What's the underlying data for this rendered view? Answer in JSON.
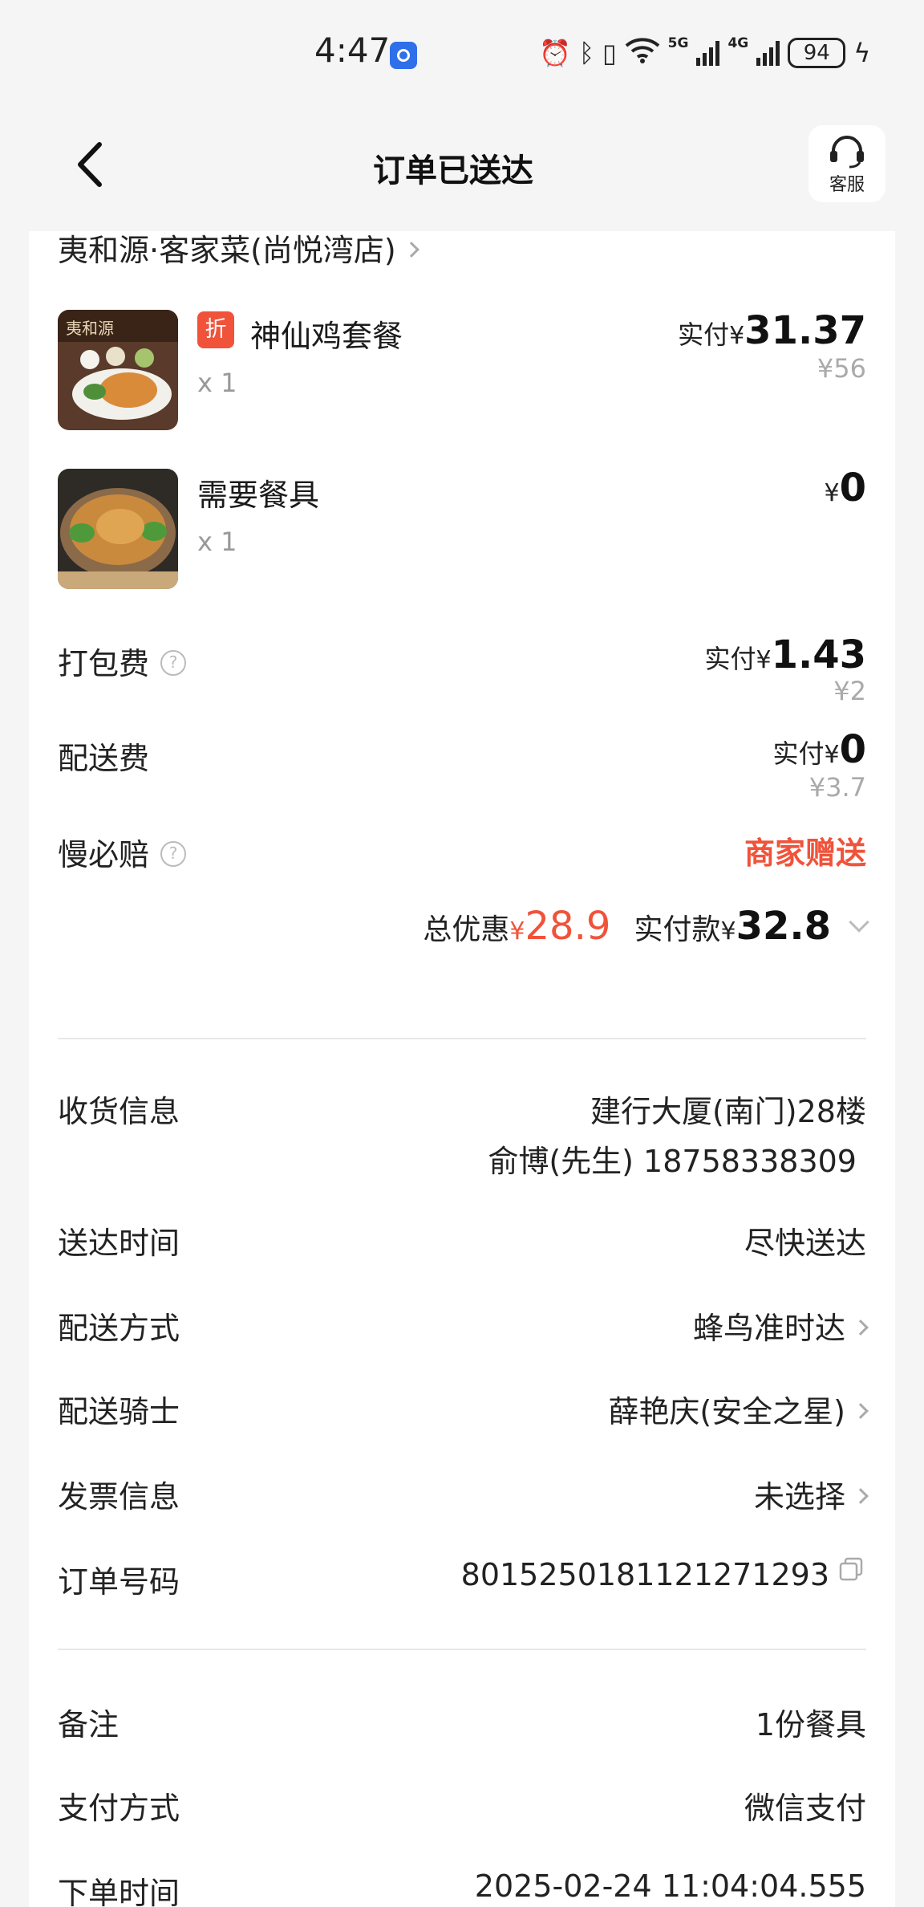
{
  "status_bar": {
    "time": "4:47",
    "network_5g": "5G",
    "network_4g": "4G",
    "battery": "94",
    "icons": [
      "app-notification-icon",
      "alarm-icon",
      "bluetooth-icon",
      "vibrate-icon",
      "wifi-icon",
      "signal-5g-icon",
      "signal-4g-icon",
      "battery-icon",
      "charging-icon"
    ]
  },
  "header": {
    "title": "订单已送达",
    "customer_service_label": "客服"
  },
  "store": {
    "name": "夷和源·客家菜(尚悦湾店)"
  },
  "items": [
    {
      "name": "神仙鸡套餐",
      "badge": "折",
      "qty": "x 1",
      "paid_label": "实付",
      "currency": "¥",
      "price": "31.37",
      "original_price": "¥56"
    },
    {
      "name": "需要餐具",
      "qty": "x 1",
      "currency": "¥",
      "price": "0"
    }
  ],
  "fees": {
    "packing": {
      "label": "打包费",
      "paid_label": "实付",
      "currency": "¥",
      "price": "1.43",
      "original": "¥2"
    },
    "delivery": {
      "label": "配送费",
      "paid_label": "实付",
      "currency": "¥",
      "price": "0",
      "original": "¥3.7"
    },
    "late_guarantee": {
      "label": "慢必赔",
      "value": "商家赠送"
    }
  },
  "summary": {
    "discount_label": "总优惠",
    "discount_currency": "¥",
    "discount_value": "28.9",
    "paid_label": "实付款",
    "paid_currency": "¥",
    "paid_value": "32.8"
  },
  "info": {
    "address_label": "收货信息",
    "address_line1": "建行大厦(南门)28楼",
    "address_line2": "俞博(先生) 18758338309",
    "delivery_time_label": "送达时间",
    "delivery_time": "尽快送达",
    "delivery_method_label": "配送方式",
    "delivery_method": "蜂鸟准时达",
    "rider_label": "配送骑士",
    "rider": "薛艳庆(安全之星)",
    "invoice_label": "发票信息",
    "invoice": "未选择",
    "order_no_label": "订单号码",
    "order_no": "8015250181121271293"
  },
  "extra": {
    "remark_label": "备注",
    "remark": "1份餐具",
    "payment_label": "支付方式",
    "payment": "微信支付",
    "order_time_label": "下单时间",
    "order_time": "2025-02-24 11:04:04.555"
  },
  "colors": {
    "accent_red": "#f0533a",
    "background": "#f5f5f5",
    "card": "#ffffff",
    "muted": "#aaaaaa"
  }
}
